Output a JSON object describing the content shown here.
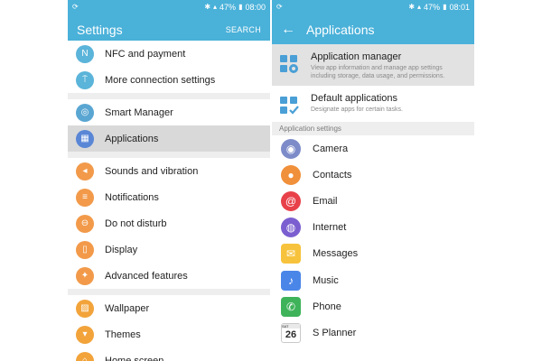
{
  "status": {
    "left_time": "08:00",
    "right_time": "08:01",
    "battery": "47%"
  },
  "left": {
    "title": "Settings",
    "search_label": "SEARCH",
    "groups": [
      [
        {
          "label": "NFC and payment",
          "icon": "nfc-icon",
          "color": "#5bb4d9",
          "glyph": "N"
        },
        {
          "label": "More connection settings",
          "icon": "antenna-icon",
          "color": "#5bb4d9",
          "glyph": "⍑"
        }
      ],
      [
        {
          "label": "Smart Manager",
          "icon": "smart-manager-icon",
          "color": "#5aa6d2",
          "glyph": "◎"
        },
        {
          "label": "Applications",
          "icon": "apps-grid-icon",
          "color": "#5a86d6",
          "glyph": "▦",
          "selected": true
        }
      ],
      [
        {
          "label": "Sounds and vibration",
          "icon": "sound-icon",
          "color": "#f29a4a",
          "glyph": "◂"
        },
        {
          "label": "Notifications",
          "icon": "notifications-icon",
          "color": "#f29a4a",
          "glyph": "≡"
        },
        {
          "label": "Do not disturb",
          "icon": "do-not-disturb-icon",
          "color": "#f29a4a",
          "glyph": "⊖"
        },
        {
          "label": "Display",
          "icon": "display-icon",
          "color": "#f29a4a",
          "glyph": "▯"
        },
        {
          "label": "Advanced features",
          "icon": "advanced-features-icon",
          "color": "#f29a4a",
          "glyph": "✦"
        }
      ],
      [
        {
          "label": "Wallpaper",
          "icon": "wallpaper-icon",
          "color": "#f2a33a",
          "glyph": "▨"
        },
        {
          "label": "Themes",
          "icon": "themes-icon",
          "color": "#f2a33a",
          "glyph": "▾"
        },
        {
          "label": "Home screen",
          "icon": "home-screen-icon",
          "color": "#f2a33a",
          "glyph": "⌂"
        }
      ]
    ]
  },
  "right": {
    "title": "Applications",
    "manager": {
      "title": "Application manager",
      "desc": "View app information and manage app settings including storage, data usage, and permissions."
    },
    "defaults": {
      "title": "Default applications",
      "desc": "Designate apps for certain tasks."
    },
    "section_title": "Application settings",
    "apps": [
      {
        "label": "Camera",
        "icon": "camera-icon",
        "color": "#7d8cc9",
        "glyph": "◉",
        "shape": "round"
      },
      {
        "label": "Contacts",
        "icon": "contacts-icon",
        "color": "#f0903a",
        "glyph": "●",
        "shape": "round"
      },
      {
        "label": "Email",
        "icon": "email-icon",
        "color": "#e8414a",
        "glyph": "@",
        "shape": "round"
      },
      {
        "label": "Internet",
        "icon": "internet-icon",
        "color": "#7b5fd0",
        "glyph": "◍",
        "shape": "round"
      },
      {
        "label": "Messages",
        "icon": "messages-icon",
        "color": "#f7c33c",
        "glyph": "✉",
        "shape": "square"
      },
      {
        "label": "Music",
        "icon": "music-icon",
        "color": "#4a86e8",
        "glyph": "♪",
        "shape": "square"
      },
      {
        "label": "Phone",
        "icon": "phone-icon",
        "color": "#3fb35a",
        "glyph": "✆",
        "shape": "square"
      },
      {
        "label": "S Planner",
        "icon": "calendar-icon",
        "color": "#ffffff",
        "glyph": "26",
        "shape": "calendar",
        "day_label": "SAT"
      }
    ]
  }
}
